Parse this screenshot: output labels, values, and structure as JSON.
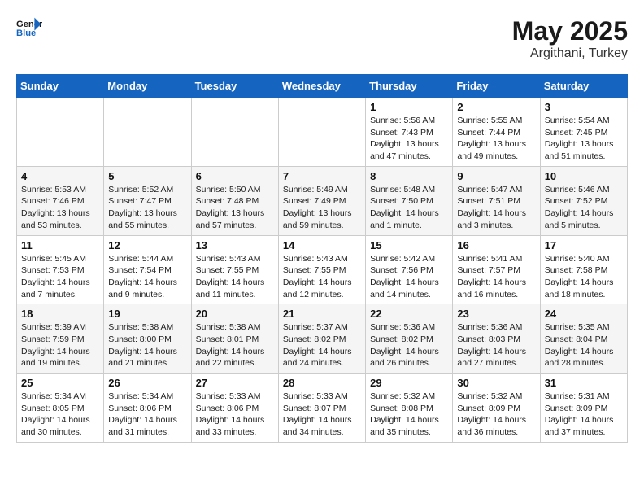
{
  "header": {
    "logo_line1": "General",
    "logo_line2": "Blue",
    "month_year": "May 2025",
    "location": "Argithani, Turkey"
  },
  "days_of_week": [
    "Sunday",
    "Monday",
    "Tuesday",
    "Wednesday",
    "Thursday",
    "Friday",
    "Saturday"
  ],
  "weeks": [
    [
      {
        "day": "",
        "detail": ""
      },
      {
        "day": "",
        "detail": ""
      },
      {
        "day": "",
        "detail": ""
      },
      {
        "day": "",
        "detail": ""
      },
      {
        "day": "1",
        "detail": "Sunrise: 5:56 AM\nSunset: 7:43 PM\nDaylight: 13 hours\nand 47 minutes."
      },
      {
        "day": "2",
        "detail": "Sunrise: 5:55 AM\nSunset: 7:44 PM\nDaylight: 13 hours\nand 49 minutes."
      },
      {
        "day": "3",
        "detail": "Sunrise: 5:54 AM\nSunset: 7:45 PM\nDaylight: 13 hours\nand 51 minutes."
      }
    ],
    [
      {
        "day": "4",
        "detail": "Sunrise: 5:53 AM\nSunset: 7:46 PM\nDaylight: 13 hours\nand 53 minutes."
      },
      {
        "day": "5",
        "detail": "Sunrise: 5:52 AM\nSunset: 7:47 PM\nDaylight: 13 hours\nand 55 minutes."
      },
      {
        "day": "6",
        "detail": "Sunrise: 5:50 AM\nSunset: 7:48 PM\nDaylight: 13 hours\nand 57 minutes."
      },
      {
        "day": "7",
        "detail": "Sunrise: 5:49 AM\nSunset: 7:49 PM\nDaylight: 13 hours\nand 59 minutes."
      },
      {
        "day": "8",
        "detail": "Sunrise: 5:48 AM\nSunset: 7:50 PM\nDaylight: 14 hours\nand 1 minute."
      },
      {
        "day": "9",
        "detail": "Sunrise: 5:47 AM\nSunset: 7:51 PM\nDaylight: 14 hours\nand 3 minutes."
      },
      {
        "day": "10",
        "detail": "Sunrise: 5:46 AM\nSunset: 7:52 PM\nDaylight: 14 hours\nand 5 minutes."
      }
    ],
    [
      {
        "day": "11",
        "detail": "Sunrise: 5:45 AM\nSunset: 7:53 PM\nDaylight: 14 hours\nand 7 minutes."
      },
      {
        "day": "12",
        "detail": "Sunrise: 5:44 AM\nSunset: 7:54 PM\nDaylight: 14 hours\nand 9 minutes."
      },
      {
        "day": "13",
        "detail": "Sunrise: 5:43 AM\nSunset: 7:55 PM\nDaylight: 14 hours\nand 11 minutes."
      },
      {
        "day": "14",
        "detail": "Sunrise: 5:43 AM\nSunset: 7:55 PM\nDaylight: 14 hours\nand 12 minutes."
      },
      {
        "day": "15",
        "detail": "Sunrise: 5:42 AM\nSunset: 7:56 PM\nDaylight: 14 hours\nand 14 minutes."
      },
      {
        "day": "16",
        "detail": "Sunrise: 5:41 AM\nSunset: 7:57 PM\nDaylight: 14 hours\nand 16 minutes."
      },
      {
        "day": "17",
        "detail": "Sunrise: 5:40 AM\nSunset: 7:58 PM\nDaylight: 14 hours\nand 18 minutes."
      }
    ],
    [
      {
        "day": "18",
        "detail": "Sunrise: 5:39 AM\nSunset: 7:59 PM\nDaylight: 14 hours\nand 19 minutes."
      },
      {
        "day": "19",
        "detail": "Sunrise: 5:38 AM\nSunset: 8:00 PM\nDaylight: 14 hours\nand 21 minutes."
      },
      {
        "day": "20",
        "detail": "Sunrise: 5:38 AM\nSunset: 8:01 PM\nDaylight: 14 hours\nand 22 minutes."
      },
      {
        "day": "21",
        "detail": "Sunrise: 5:37 AM\nSunset: 8:02 PM\nDaylight: 14 hours\nand 24 minutes."
      },
      {
        "day": "22",
        "detail": "Sunrise: 5:36 AM\nSunset: 8:02 PM\nDaylight: 14 hours\nand 26 minutes."
      },
      {
        "day": "23",
        "detail": "Sunrise: 5:36 AM\nSunset: 8:03 PM\nDaylight: 14 hours\nand 27 minutes."
      },
      {
        "day": "24",
        "detail": "Sunrise: 5:35 AM\nSunset: 8:04 PM\nDaylight: 14 hours\nand 28 minutes."
      }
    ],
    [
      {
        "day": "25",
        "detail": "Sunrise: 5:34 AM\nSunset: 8:05 PM\nDaylight: 14 hours\nand 30 minutes."
      },
      {
        "day": "26",
        "detail": "Sunrise: 5:34 AM\nSunset: 8:06 PM\nDaylight: 14 hours\nand 31 minutes."
      },
      {
        "day": "27",
        "detail": "Sunrise: 5:33 AM\nSunset: 8:06 PM\nDaylight: 14 hours\nand 33 minutes."
      },
      {
        "day": "28",
        "detail": "Sunrise: 5:33 AM\nSunset: 8:07 PM\nDaylight: 14 hours\nand 34 minutes."
      },
      {
        "day": "29",
        "detail": "Sunrise: 5:32 AM\nSunset: 8:08 PM\nDaylight: 14 hours\nand 35 minutes."
      },
      {
        "day": "30",
        "detail": "Sunrise: 5:32 AM\nSunset: 8:09 PM\nDaylight: 14 hours\nand 36 minutes."
      },
      {
        "day": "31",
        "detail": "Sunrise: 5:31 AM\nSunset: 8:09 PM\nDaylight: 14 hours\nand 37 minutes."
      }
    ]
  ]
}
